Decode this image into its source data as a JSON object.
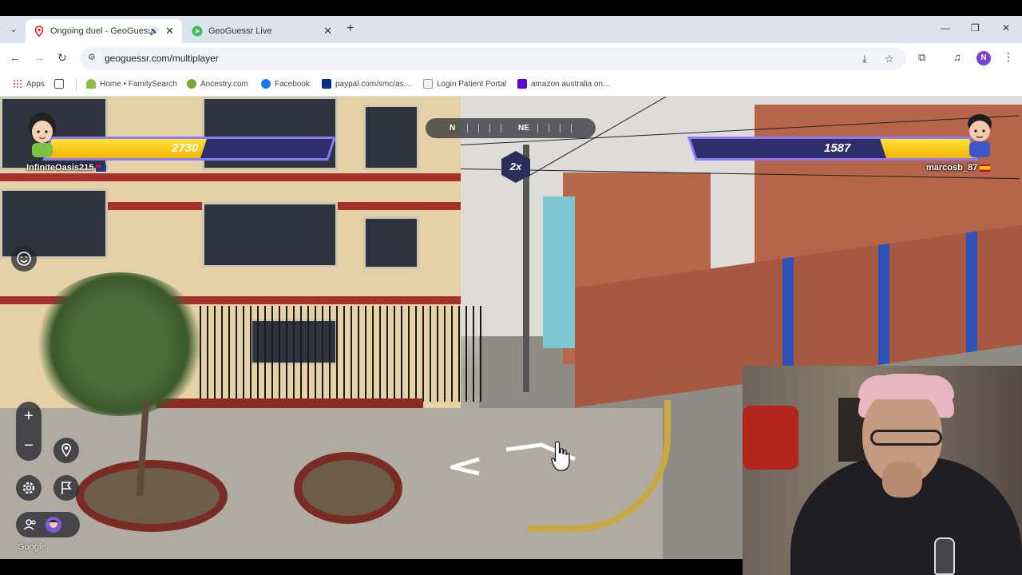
{
  "browser": {
    "tabs": [
      {
        "title": "Ongoing duel - GeoGuessr",
        "active": true,
        "audio": true
      },
      {
        "title": "GeoGuessr Live",
        "active": false,
        "audio": false
      }
    ],
    "url": "geoguessr.com/multiplayer",
    "profile_initial": "N",
    "bookmarks": [
      {
        "label": "Apps",
        "icon": "apps-grid-icon"
      },
      {
        "label": "Home • FamilySearch",
        "icon": "familysearch-icon"
      },
      {
        "label": "Ancestry.com",
        "icon": "ancestry-icon"
      },
      {
        "label": "Facebook",
        "icon": "facebook-icon"
      },
      {
        "label": "paypal.com/smc/as...",
        "icon": "paypal-icon"
      },
      {
        "label": "Login Patient Portal",
        "icon": "document-icon"
      },
      {
        "label": "amazon australia on...",
        "icon": "yahoo-icon"
      }
    ]
  },
  "game": {
    "compass": {
      "labels": [
        "N",
        "NE"
      ]
    },
    "multiplier": "2x",
    "player_left": {
      "name": "InfiniteOasis215",
      "health": "2730",
      "health_fraction": 0.55,
      "country": "australia-flag"
    },
    "player_right": {
      "name": "marcosb_87",
      "health": "1587",
      "health_fraction": 0.32,
      "country": "spain-flag"
    },
    "controls": {
      "zoom_in": "+",
      "zoom_out": "−"
    },
    "attribution": "Google"
  },
  "colors": {
    "health_fill": "#f3b400",
    "health_bg": "#2c2f6b",
    "health_border": "#8b7cff",
    "accent_tab": "#dde3ee"
  }
}
